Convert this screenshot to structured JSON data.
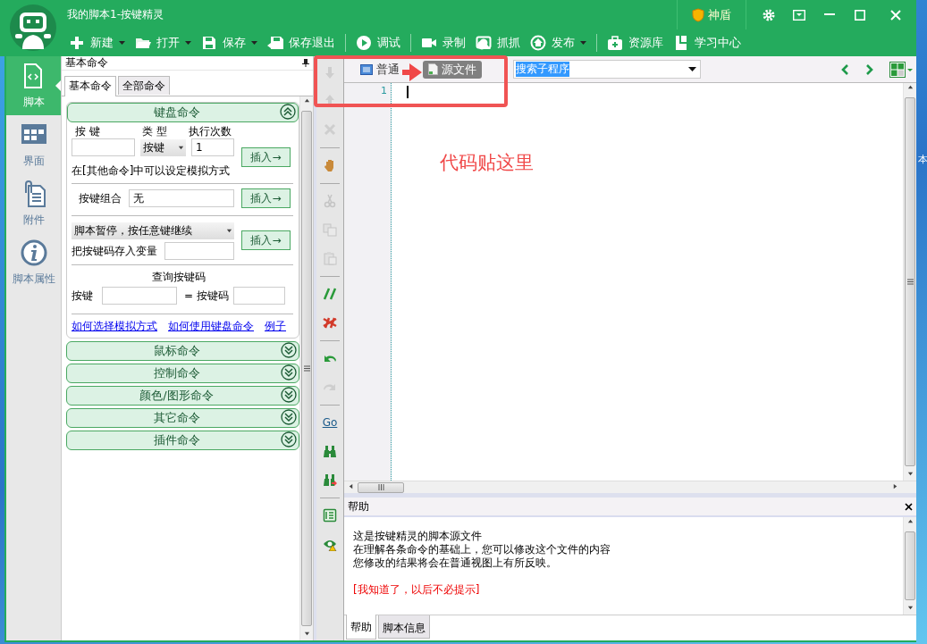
{
  "window": {
    "title": "我的脚本1-按键精灵",
    "shield_label": "神盾"
  },
  "toolbar": [
    {
      "kind": "plus",
      "label": "新建",
      "dropdown": true
    },
    {
      "kind": "folder",
      "label": "打开",
      "dropdown": true
    },
    {
      "kind": "floppy",
      "label": "保存",
      "dropdown": true
    },
    {
      "kind": "floppy-exit",
      "label": "保存退出",
      "dropdown": false
    },
    {
      "kind": "separator"
    },
    {
      "kind": "play",
      "label": "调试",
      "dropdown": false
    },
    {
      "kind": "separator"
    },
    {
      "kind": "camera",
      "label": "录制",
      "dropdown": false
    },
    {
      "kind": "capture",
      "label": "抓抓",
      "dropdown": false
    },
    {
      "kind": "publish",
      "label": "发布",
      "dropdown": true
    },
    {
      "kind": "separator"
    },
    {
      "kind": "kit",
      "label": "资源库",
      "dropdown": false
    },
    {
      "kind": "book",
      "label": "学习中心",
      "dropdown": false
    }
  ],
  "nav": [
    {
      "kind": "script",
      "label": "脚本",
      "selected": true
    },
    {
      "kind": "ui",
      "label": "界面",
      "selected": false
    },
    {
      "kind": "attach",
      "label": "附件",
      "selected": false
    },
    {
      "kind": "info",
      "label": "脚本属性",
      "selected": false
    }
  ],
  "command_panel": {
    "title": "基本命令",
    "tabs": [
      {
        "label": "基本命令",
        "selected": true
      },
      {
        "label": "全部命令",
        "selected": false
      }
    ],
    "keyboard": {
      "title": "键盘命令",
      "expanded": true,
      "key_label": "按 键",
      "type_label": "类 型",
      "count_label": "执行次数",
      "type_value": "按键",
      "count_value": "1",
      "insert_label": "插入→",
      "note": "在[其他命令]中可以设定模拟方式",
      "combo_label": "按键组合",
      "combo_value": "无",
      "combo_insert": "插入→",
      "pause_value": "脚本暂停，按任意键继续",
      "store_label": "把按键码存入变量",
      "pause_insert": "插入→",
      "query_title": "查询按键码",
      "query_key_label": "按键",
      "query_code_label": "= 按键码",
      "links": [
        "如何选择模拟方式",
        "如何使用键盘命令",
        "例子"
      ]
    },
    "sections": [
      {
        "title": "鼠标命令",
        "expanded": false
      },
      {
        "title": "控制命令",
        "expanded": false
      },
      {
        "title": "颜色/图形命令",
        "expanded": false
      },
      {
        "title": "其它命令",
        "expanded": false
      },
      {
        "title": "插件命令",
        "expanded": false
      }
    ]
  },
  "vertical_toolbar": [
    {
      "kind": "down",
      "disabled": true
    },
    {
      "kind": "up",
      "disabled": true
    },
    {
      "kind": "delete",
      "disabled": true
    },
    {
      "kind": "separator"
    },
    {
      "kind": "hand",
      "disabled": false
    },
    {
      "kind": "separator"
    },
    {
      "kind": "cut",
      "disabled": true
    },
    {
      "kind": "copy",
      "disabled": true
    },
    {
      "kind": "paste",
      "disabled": true
    },
    {
      "kind": "separator"
    },
    {
      "kind": "comment",
      "disabled": false
    },
    {
      "kind": "uncomment",
      "disabled": false
    },
    {
      "kind": "separator"
    },
    {
      "kind": "undo",
      "disabled": false
    },
    {
      "kind": "redo",
      "disabled": true
    },
    {
      "kind": "separator"
    },
    {
      "kind": "go",
      "label": "Go",
      "disabled": false
    },
    {
      "kind": "find",
      "disabled": false
    },
    {
      "kind": "find-next",
      "disabled": false
    },
    {
      "kind": "separator"
    },
    {
      "kind": "list",
      "disabled": false
    },
    {
      "kind": "watch",
      "disabled": false
    }
  ],
  "editor": {
    "tabs": [
      {
        "label": "普通",
        "selected": false
      },
      {
        "label": "源文件",
        "selected": true
      }
    ],
    "search": {
      "value": "搜索子程序"
    },
    "line_numbers": [
      "1"
    ]
  },
  "help": {
    "title": "帮助",
    "lines": [
      "这是按键精灵的脚本源文件",
      "在理解各条命令的基础上，您可以修改这个文件的内容",
      "您修改的结果将会在普通视图上有所反映。"
    ],
    "dismiss_link": "[我知道了，以后不必提示]",
    "tabs": [
      {
        "label": "帮助",
        "selected": true
      },
      {
        "label": "脚本信息",
        "selected": false
      }
    ]
  },
  "annotation": {
    "text": "代码贴这里"
  },
  "desktop": {
    "fragment": "本"
  }
}
